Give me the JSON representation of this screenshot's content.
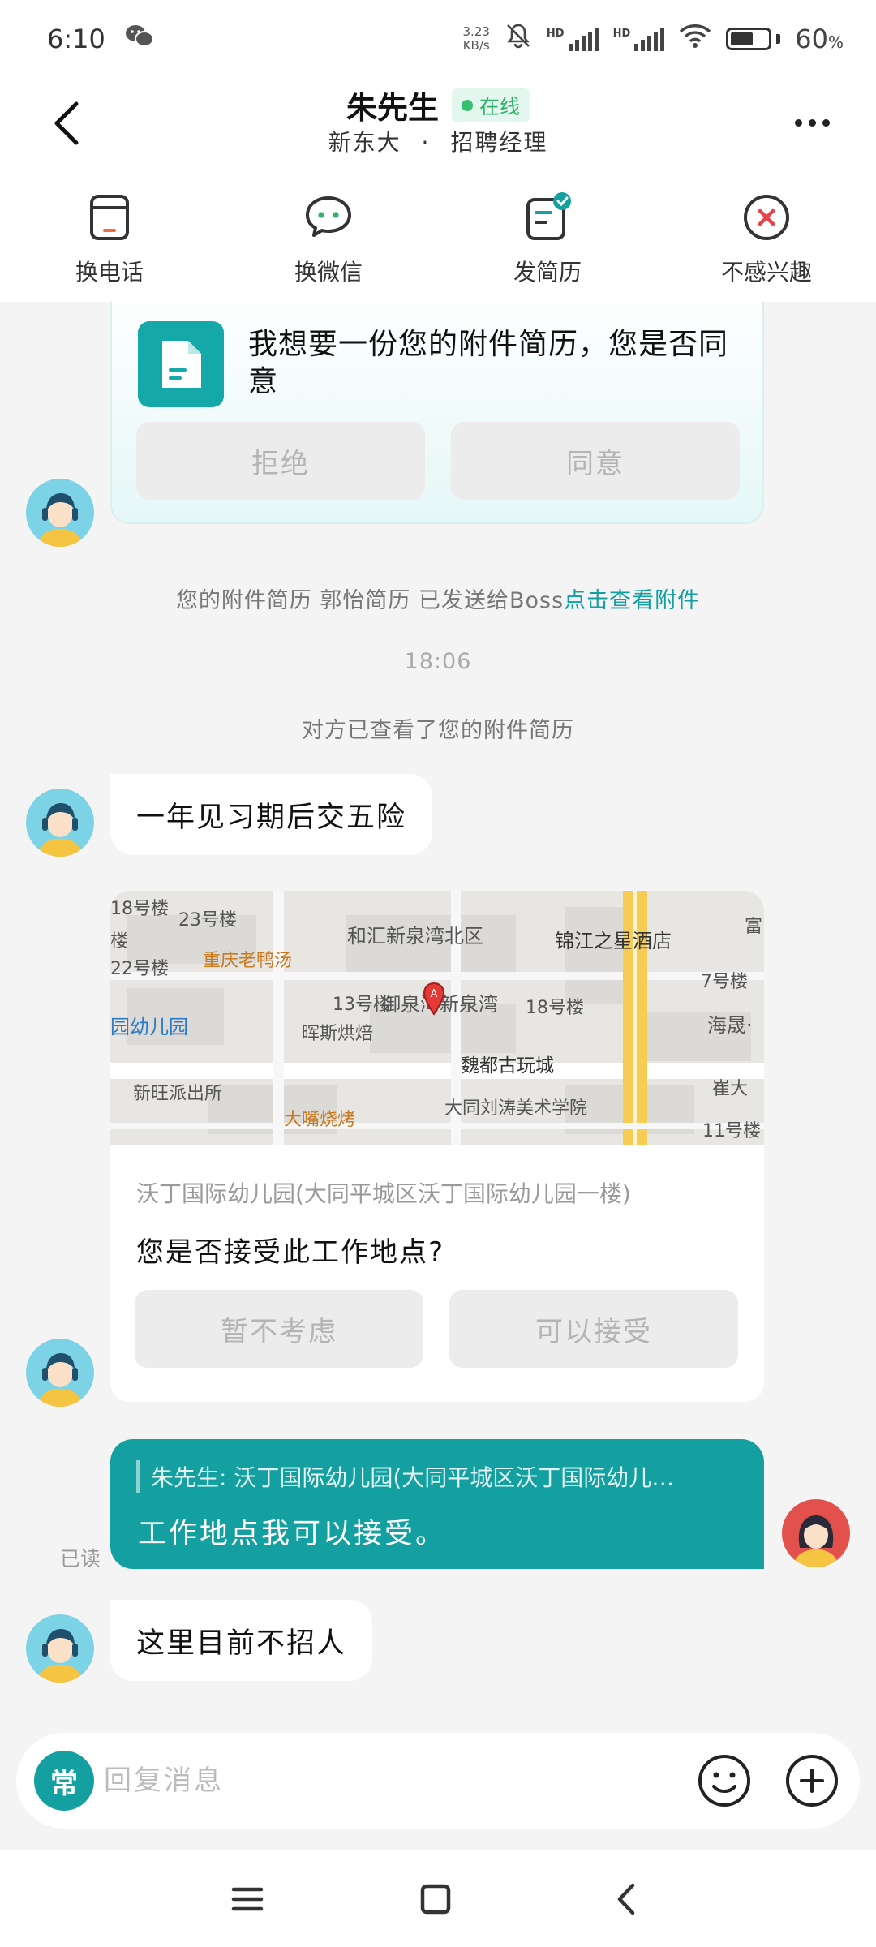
{
  "status": {
    "time": "6:10",
    "net_speed_value": "3.23",
    "net_speed_unit": "KB/s",
    "hd1": "HD",
    "hd2": "HD",
    "battery": "60",
    "battery_unit": "%",
    "battery_level": 0.6
  },
  "header": {
    "name": "朱先生",
    "online": "在线",
    "company": "新东大",
    "separator": "·",
    "role": "招聘经理"
  },
  "quick_actions": [
    {
      "label": "换电话",
      "icon": "phone-swap-icon"
    },
    {
      "label": "换微信",
      "icon": "wechat-swap-icon"
    },
    {
      "label": "发简历",
      "icon": "send-resume-icon"
    },
    {
      "label": "不感兴趣",
      "icon": "not-interested-icon"
    }
  ],
  "chat": {
    "request_card": {
      "text": "我想要一份您的附件简历，您是否同意",
      "reject": "拒绝",
      "agree": "同意"
    },
    "system_sent": {
      "prefix": "您的附件简历 郭怡简历 已发送给Boss",
      "link": "点击查看附件"
    },
    "timestamp": "18:06",
    "system_viewed": "对方已查看了您的附件简历",
    "msg1": "一年见习期后交五险",
    "map_card": {
      "labels": {
        "b18": "18号楼",
        "b23": "23号楼",
        "lou": "楼",
        "heihui": "和汇新泉湾北区",
        "jinjiang": "锦江之星酒店",
        "fu": "富",
        "b22": "22号楼",
        "chongqing": "重庆老鸭汤",
        "b7": "7号楼",
        "b13": "13号楼",
        "yuquan": "御泉湾新泉湾",
        "b18b": "18号楼",
        "haisheng": "海晟·",
        "yuan": "园幼儿园",
        "huisi": "晖斯烘焙",
        "weidu": "魏都古玩城",
        "xinwang": "新旺派出所",
        "datong": "大同刘涛美术学院",
        "cuida": "崔大",
        "dazui": "大嘴烧烤",
        "b11": "11号楼",
        "pin": "A"
      },
      "address": "沃丁国际幼儿园(大同平城区沃丁国际幼儿园一楼)",
      "question": "您是否接受此工作地点?",
      "decline": "暂不考虑",
      "accept": "可以接受"
    },
    "my_reply": {
      "quote": "朱先生: 沃丁国际幼儿园(大同平城区沃丁国际幼儿…",
      "text": "工作地点我可以接受。",
      "read": "已读"
    },
    "msg2": "这里目前不招人"
  },
  "input": {
    "quick_reply": "常",
    "placeholder": "回复消息"
  },
  "colors": {
    "accent": "#14a0a0",
    "online": "#33c16f"
  }
}
